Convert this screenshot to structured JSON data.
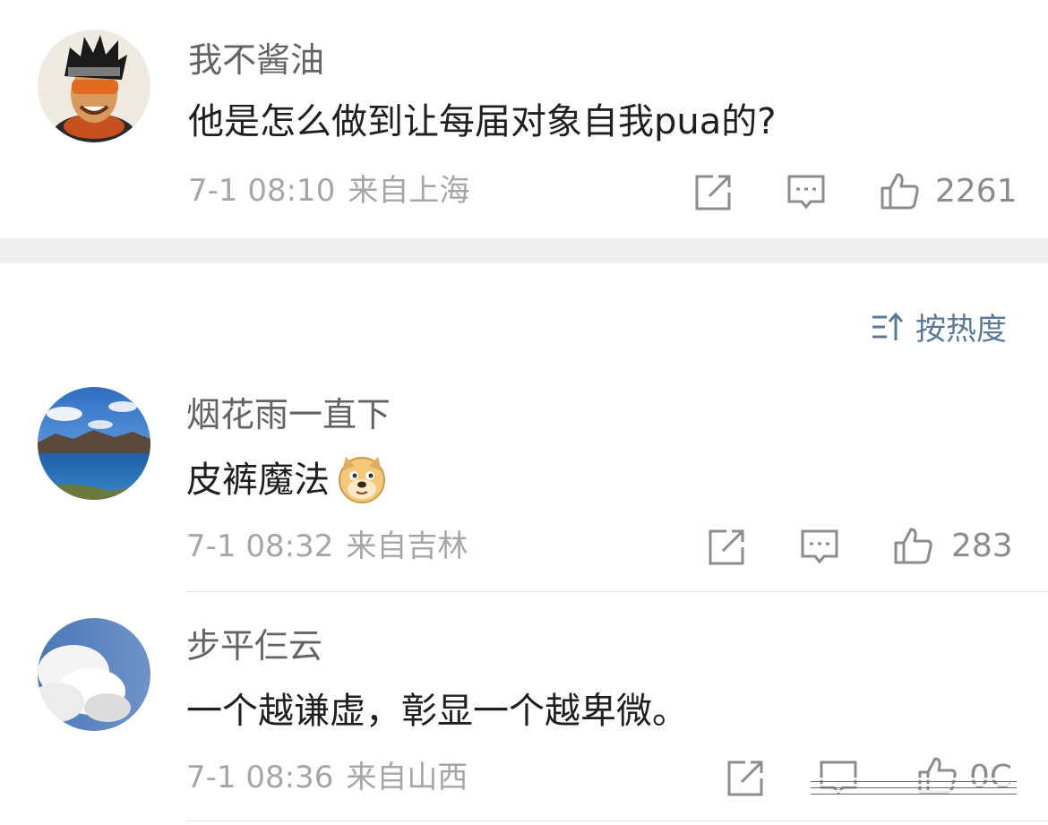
{
  "top_comment": {
    "user": "我不酱油",
    "text": "他是怎么做到让每届对象自我pua的?",
    "time": "7-1 08:10",
    "location": "来自上海",
    "likes": "2261"
  },
  "sort": {
    "label": "按热度"
  },
  "comments": [
    {
      "user": "烟花雨一直下",
      "text": "皮裤魔法",
      "emoji": "doge-emoji",
      "time": "7-1 08:32",
      "location": "来自吉林",
      "likes": "283"
    },
    {
      "user": "步平仨云",
      "text": "一个越谦虚，彰显一个越卑微。",
      "time": "7-1 08:36",
      "location": "来自山西",
      "likes": "0C"
    }
  ],
  "colors": {
    "link_blue": "#5b7a9b",
    "meta_gray": "#a6a6a6",
    "separator_band": "#efefef"
  },
  "icons": [
    "share-icon",
    "comment-icon",
    "like-icon",
    "sort-icon"
  ]
}
